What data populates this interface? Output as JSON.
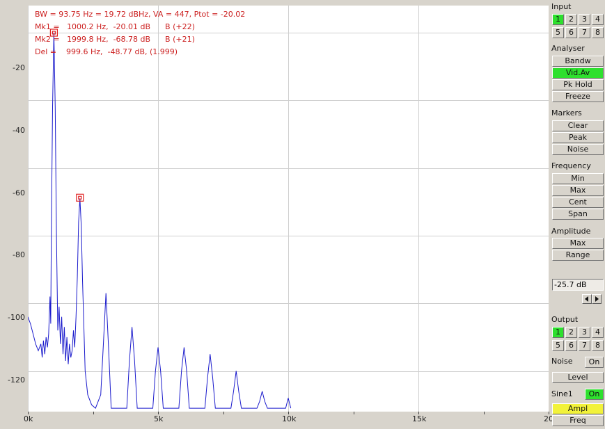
{
  "readouts": {
    "line1": "BW = 93.75 Hz = 19.72 dBHz, VA = 447, Ptot = -20.02",
    "line2": "Mk1 =   1000.2 Hz,  -20.01 dB      B (+22)",
    "line3": "Mk2 =   1999.8 Hz,  -68.78 dB      B (+21)",
    "line4": "Del =    999.6 Hz,  -48.77 dB, (1.999)"
  },
  "y_axis": {
    "labels": [
      "-20",
      "-40",
      "-60",
      "-80",
      "-100",
      "-120"
    ]
  },
  "x_axis": {
    "labels": [
      "0k",
      "5k",
      "10k",
      "15k",
      "20"
    ]
  },
  "panel": {
    "input": {
      "title": "Input",
      "channels": [
        "1",
        "2",
        "3",
        "4",
        "5",
        "6",
        "7",
        "8"
      ],
      "active": "1"
    },
    "analyser": {
      "title": "Analyser",
      "bandw": "Bandw",
      "vidav": "Vid.Av",
      "pkhold": "Pk Hold",
      "freeze": "Freeze"
    },
    "markers": {
      "title": "Markers",
      "clear": "Clear",
      "peak": "Peak",
      "noise": "Noise"
    },
    "frequency": {
      "title": "Frequency",
      "min": "Min",
      "max": "Max",
      "cent": "Cent",
      "span": "Span"
    },
    "amplitude": {
      "title": "Amplitude",
      "max": "Max",
      "range": "Range"
    },
    "value_field": "-25.7 dB",
    "output": {
      "title": "Output",
      "channels": [
        "1",
        "2",
        "3",
        "4",
        "5",
        "6",
        "7",
        "8"
      ],
      "active": "1"
    },
    "noise": {
      "label": "Noise",
      "toggle": "On",
      "level": "Level"
    },
    "sine": {
      "label": "Sine1",
      "toggle": "On",
      "ampl": "Ampl",
      "freq": "Freq"
    }
  },
  "colors": {
    "trace": "#1a1acc",
    "markers": "#e02020",
    "active_green": "#2ee02e",
    "active_yellow": "#f2f23a"
  },
  "chart_data": {
    "type": "line",
    "xlim": [
      0,
      20000
    ],
    "ylim": [
      -132,
      -12
    ],
    "grid": true,
    "x_ticks": [
      0,
      5000,
      10000,
      15000,
      20000
    ],
    "y_ticks": [
      -20,
      -40,
      -60,
      -80,
      -100,
      -120
    ],
    "series": [
      {
        "points": [
          [
            0,
            -104
          ],
          [
            100,
            -106
          ],
          [
            200,
            -109
          ],
          [
            300,
            -112
          ],
          [
            400,
            -114
          ],
          [
            500,
            -112
          ],
          [
            550,
            -116
          ],
          [
            600,
            -111
          ],
          [
            650,
            -115
          ],
          [
            700,
            -110
          ],
          [
            750,
            -113
          ],
          [
            800,
            -109
          ],
          [
            850,
            -98
          ],
          [
            880,
            -106
          ],
          [
            900,
            -80
          ],
          [
            950,
            -42
          ],
          [
            1000,
            -20
          ],
          [
            1050,
            -42
          ],
          [
            1100,
            -80
          ],
          [
            1150,
            -108
          ],
          [
            1200,
            -101
          ],
          [
            1250,
            -112
          ],
          [
            1300,
            -104
          ],
          [
            1350,
            -115
          ],
          [
            1400,
            -107
          ],
          [
            1450,
            -117
          ],
          [
            1500,
            -110
          ],
          [
            1550,
            -118
          ],
          [
            1600,
            -112
          ],
          [
            1650,
            -116
          ],
          [
            1700,
            -114
          ],
          [
            1750,
            -108
          ],
          [
            1800,
            -113
          ],
          [
            1850,
            -104
          ],
          [
            1900,
            -92
          ],
          [
            1950,
            -76
          ],
          [
            2000,
            -69
          ],
          [
            2050,
            -77
          ],
          [
            2100,
            -93
          ],
          [
            2200,
            -120
          ],
          [
            2300,
            -127
          ],
          [
            2450,
            -130
          ],
          [
            2600,
            -131
          ],
          [
            2800,
            -127
          ],
          [
            2900,
            -112
          ],
          [
            3000,
            -97
          ],
          [
            3100,
            -113
          ],
          [
            3200,
            -131
          ],
          [
            3800,
            -131
          ],
          [
            3900,
            -117
          ],
          [
            4000,
            -107
          ],
          [
            4100,
            -117
          ],
          [
            4200,
            -131
          ],
          [
            4800,
            -131
          ],
          [
            4900,
            -120
          ],
          [
            5000,
            -113
          ],
          [
            5100,
            -120
          ],
          [
            5200,
            -131
          ],
          [
            5800,
            -131
          ],
          [
            5900,
            -120
          ],
          [
            6000,
            -113
          ],
          [
            6100,
            -120
          ],
          [
            6200,
            -131
          ],
          [
            6800,
            -131
          ],
          [
            6900,
            -122
          ],
          [
            7000,
            -115
          ],
          [
            7100,
            -122
          ],
          [
            7200,
            -131
          ],
          [
            7800,
            -131
          ],
          [
            7900,
            -126
          ],
          [
            8000,
            -120
          ],
          [
            8100,
            -126
          ],
          [
            8200,
            -131
          ],
          [
            8800,
            -131
          ],
          [
            8900,
            -129
          ],
          [
            9000,
            -126
          ],
          [
            9100,
            -129
          ],
          [
            9200,
            -131
          ],
          [
            9900,
            -131
          ],
          [
            10000,
            -128
          ],
          [
            10100,
            -131
          ]
        ]
      }
    ],
    "markers": [
      {
        "freq_hz": 1000.2,
        "level_db": -20.01
      },
      {
        "freq_hz": 1999.8,
        "level_db": -68.78
      }
    ]
  }
}
